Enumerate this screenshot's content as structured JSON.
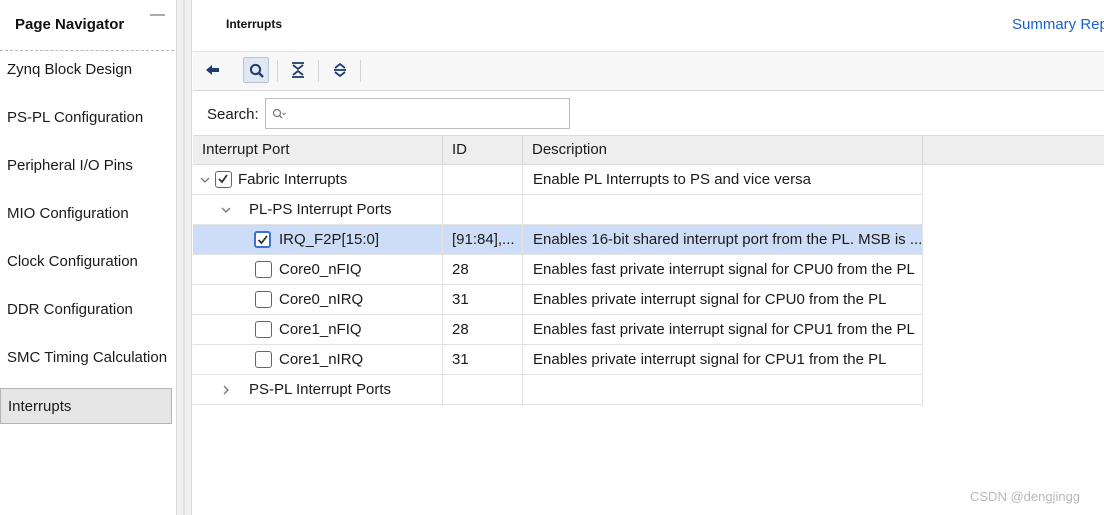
{
  "navigator": {
    "title": "Page Navigator",
    "items": [
      {
        "label": "Zynq Block Design"
      },
      {
        "label": "PS-PL Configuration"
      },
      {
        "label": "Peripheral I/O Pins"
      },
      {
        "label": "MIO Configuration"
      },
      {
        "label": "Clock Configuration"
      },
      {
        "label": "DDR Configuration"
      },
      {
        "label": "SMC Timing Calculation"
      },
      {
        "label": "Interrupts"
      }
    ],
    "selected": "Interrupts"
  },
  "main": {
    "title": "Interrupts",
    "summary_link": "Summary Rep"
  },
  "toolbar": {
    "buttons": [
      "back-icon",
      "search-icon",
      "collapse-all-icon",
      "expand-all-icon"
    ]
  },
  "search": {
    "label": "Search:",
    "placeholder": "",
    "value": ""
  },
  "table": {
    "headers": {
      "port": "Interrupt Port",
      "id": "ID",
      "description": "Description"
    },
    "rows": [
      {
        "port": "Fabric Interrupts",
        "id": "",
        "description": "Enable PL Interrupts to PS and vice versa",
        "checked": true,
        "expanded": true
      },
      {
        "port": "PL-PS Interrupt Ports",
        "id": "",
        "description": "",
        "expanded": true
      },
      {
        "port": "IRQ_F2P[15:0]",
        "id": "[91:84],...",
        "description": "Enables 16-bit shared interrupt port from the PL. MSB is ...",
        "checked": true,
        "selected": true
      },
      {
        "port": "Core0_nFIQ",
        "id": "28",
        "description": "Enables fast private interrupt signal for CPU0 from the PL",
        "checked": false
      },
      {
        "port": "Core0_nIRQ",
        "id": "31",
        "description": "Enables private interrupt signal for CPU0 from the PL",
        "checked": false
      },
      {
        "port": "Core1_nFIQ",
        "id": "28",
        "description": "Enables fast private interrupt signal for CPU1 from the PL",
        "checked": false
      },
      {
        "port": "Core1_nIRQ",
        "id": "31",
        "description": "Enables private interrupt signal for CPU1 from the PL",
        "checked": false
      },
      {
        "port": "PS-PL Interrupt Ports",
        "id": "",
        "description": "",
        "expanded": false
      }
    ]
  },
  "watermark": "CSDN @dengjingg",
  "colors": {
    "selection": "#cddcf7",
    "link": "#1a5fd1",
    "focus": "#3a6fd8"
  }
}
